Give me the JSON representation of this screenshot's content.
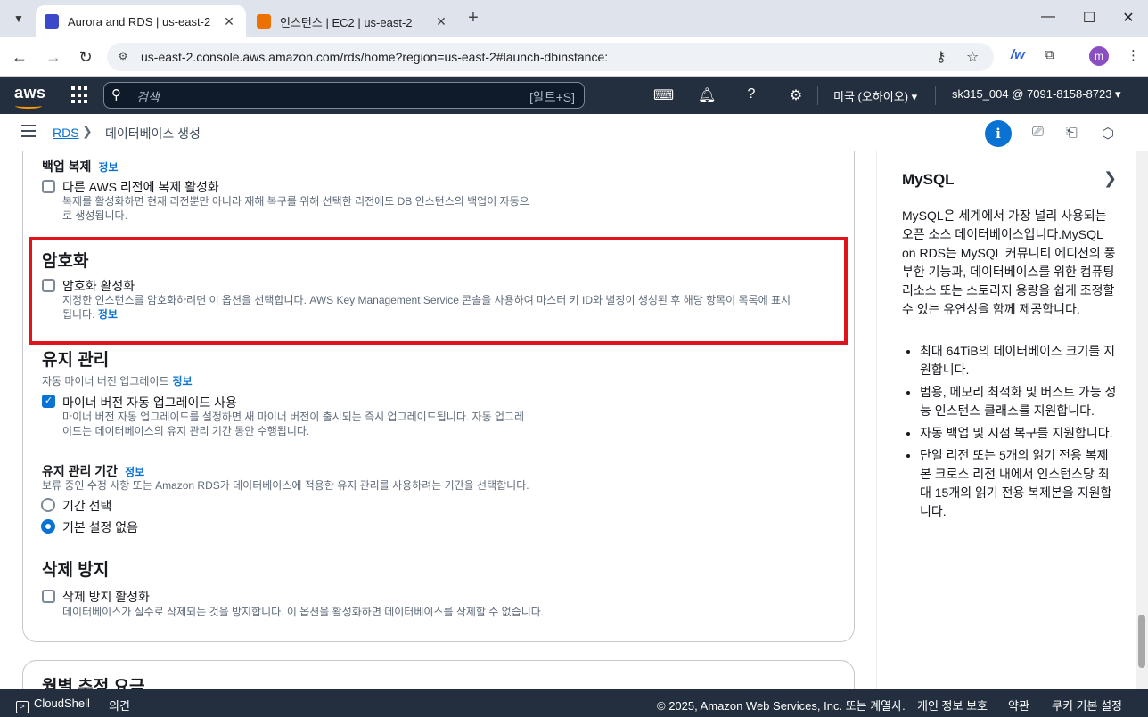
{
  "browser": {
    "tabs": [
      {
        "title": "Aurora and RDS | us-east-2",
        "favicon_color": "#3b48cc",
        "active": true
      },
      {
        "title": "인스턴스 | EC2 | us-east-2",
        "favicon_color": "#ed7100",
        "active": false
      }
    ],
    "url": "us-east-2.console.aws.amazon.com/rds/home?region=us-east-2#launch-dbinstance:",
    "profile_initial": "m"
  },
  "awsnav": {
    "logo": "aws",
    "search_placeholder": "검색",
    "search_shortcut": "[알트+S]",
    "region": "미국 (오하이오) ▾",
    "account": "sk315_004 @ 7091-8158-8723 ▾"
  },
  "breadcrumb": {
    "root": "RDS",
    "current": "데이터베이스 생성"
  },
  "form": {
    "backup_replication": {
      "title": "백업 복제",
      "info": "정보",
      "checkbox_label": "다른 AWS 리전에 복제 활성화",
      "checked": false,
      "desc_line1": "복제를 활성화하면 현재 리전뿐만 아니라 재해 복구를 위해 선택한 리전에도 DB 인스턴스의 백업이 자동으",
      "desc_line2": "로 생성됩니다."
    },
    "encryption": {
      "title": "암호화",
      "checkbox_label": "암호화 활성화",
      "checked": false,
      "desc_line1": "지정한 인스턴스를 암호화하려면 이 옵션을 선택합니다. AWS Key Management Service 콘솔을 사용하여 마스터 키 ID와 별칭이 생성된 후 해당 항목이 목록에 표시",
      "desc_line2": "됩니다.",
      "info": "정보"
    },
    "maintenance": {
      "title": "유지 관리",
      "subtitle": "자동 마이너 버전 업그레이드",
      "info": "정보",
      "checkbox_label": "마이너 버전 자동 업그레이드 사용",
      "checked": true,
      "desc_line1": "마이너 버전 자동 업그레이드를 설정하면 새 마이너 버전이 출시되는 즉시 업그레이드됩니다. 자동 업그레",
      "desc_line2": "이드는 데이터베이스의 유지 관리 기간 동안 수행됩니다."
    },
    "maintenance_window": {
      "title": "유지 관리 기간",
      "info": "정보",
      "desc": "보류 중인 수정 사항 또는 Amazon RDS가 데이터베이스에 적용한 유지 관리를 사용하려는 기간을 선택합니다.",
      "options": [
        {
          "label": "기간 선택",
          "selected": false
        },
        {
          "label": "기본 설정 없음",
          "selected": true
        }
      ]
    },
    "deletion_protection": {
      "title": "삭제 방지",
      "checkbox_label": "삭제 방지 활성화",
      "checked": false,
      "desc": "데이터베이스가 실수로 삭제되는 것을 방지합니다. 이 옵션을 활성화하면 데이터베이스를 삭제할 수 없습니다."
    },
    "next_section_title": "월별 추정 요금"
  },
  "side_panel": {
    "title": "MySQL",
    "paragraph": "MySQL은 세계에서 가장 널리 사용되는 오픈 소스 데이터베이스입니다.MySQL on RDS는 MySQL 커뮤니티 에디션의 풍부한 기능과, 데이터베이스를 위한 컴퓨팅 리소스 또는 스토리지 용량을 쉽게 조정할 수 있는 유연성을 함께 제공합니다.",
    "bullets": [
      "최대 64TiB의 데이터베이스 크기를 지원합니다.",
      "범용, 메모리 최적화 및 버스트 가능 성능 인스턴스 클래스를 지원합니다.",
      "자동 백업 및 시점 복구를 지원합니다.",
      "단일 리전 또는 5개의 읽기 전용 복제본 크로스 리전 내에서 인스턴스당 최대 15개의 읽기 전용 복제본을 지원합니다."
    ]
  },
  "footer": {
    "cloudshell": "CloudShell",
    "feedback": "의견",
    "copyright": "© 2025, Amazon Web Services, Inc. 또는 계열사.",
    "privacy": "개인 정보 보호",
    "terms": "약관",
    "cookies": "쿠키 기본 설정"
  }
}
